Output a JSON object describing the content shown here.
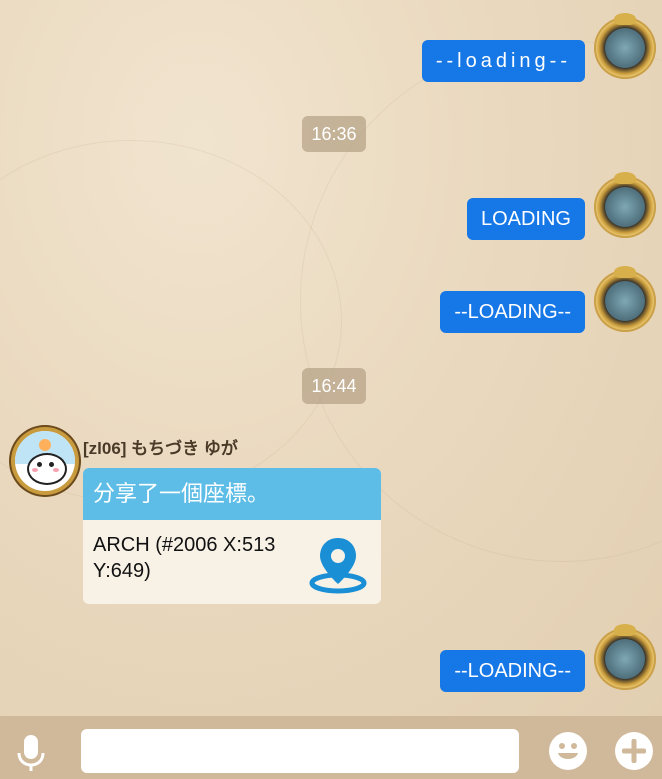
{
  "messages": {
    "m1": "--loading--",
    "t1": "16:36",
    "m2": "LOADING",
    "m3": "--LOADING--",
    "t2": "16:44",
    "m4": "--LOADING--"
  },
  "incoming": {
    "sender": "[zl06] もちづき ゆが",
    "card_title": "分享了一個座標。",
    "card_text": "ARCH (#2006 X:513 Y:649)"
  },
  "input": {
    "placeholder": ""
  },
  "icons": {
    "mic": "microphone-icon",
    "emoji": "emoji-icon",
    "plus": "plus-icon",
    "location": "location-pin-icon"
  },
  "colors": {
    "outgoing_bubble": "#1677e6",
    "card_header": "#5dbde6",
    "background": "#ead9bf"
  }
}
